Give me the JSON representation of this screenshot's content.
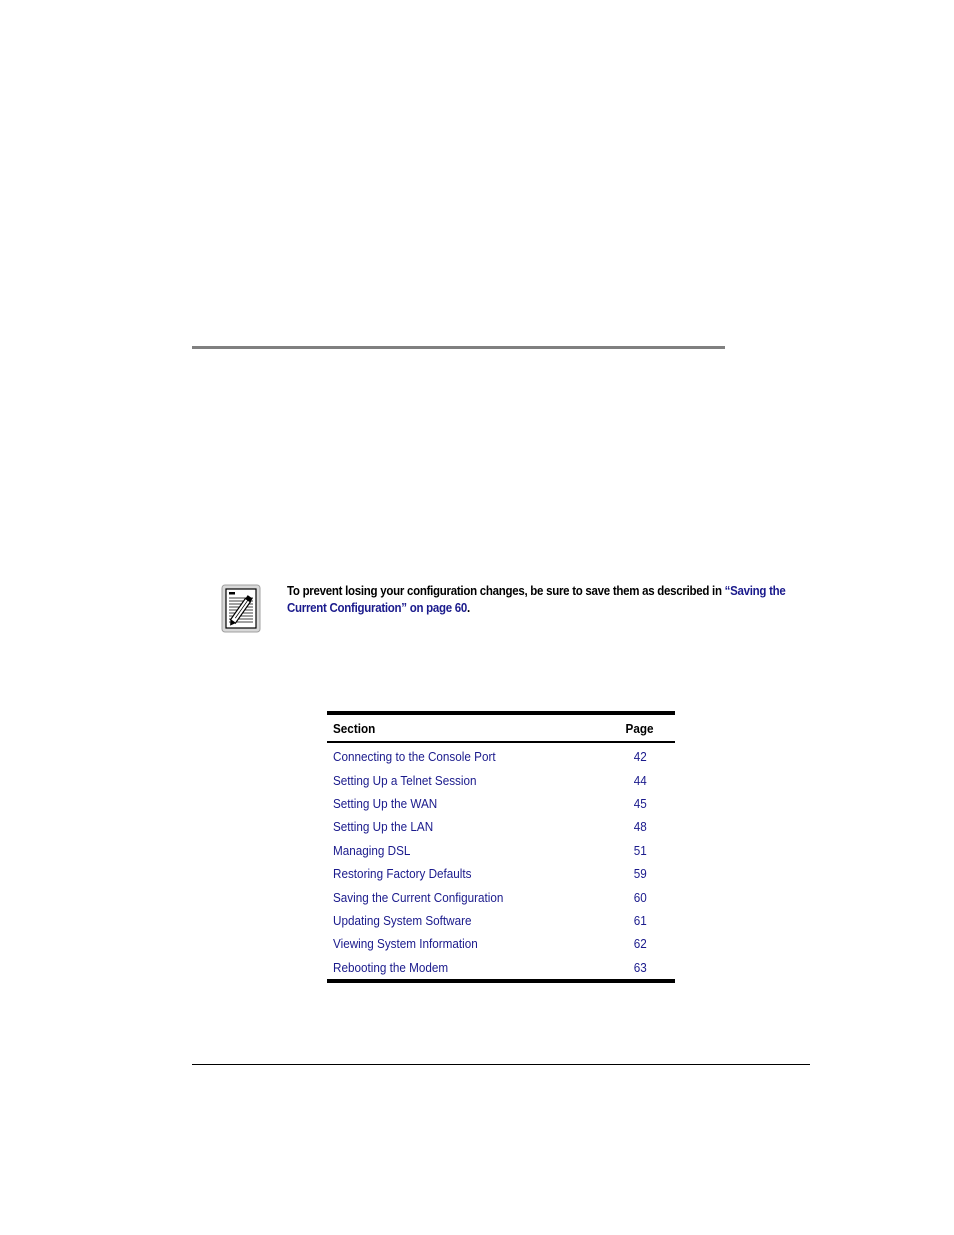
{
  "note": {
    "icon": "note-pencil-icon",
    "text_before": "To prevent losing your configuration changes, be sure to save them as described in ",
    "link_text": "“Saving the Current Configuration” on page 60",
    "text_after": ".",
    "link_color": "#1a1a8c"
  },
  "toc": {
    "headers": {
      "section": "Section",
      "page": "Page"
    },
    "rows": [
      {
        "section": "Connecting to the Console Port",
        "page": "42"
      },
      {
        "section": "Setting Up a Telnet Session",
        "page": "44"
      },
      {
        "section": "Setting Up the WAN",
        "page": "45"
      },
      {
        "section": "Setting Up the LAN",
        "page": "48"
      },
      {
        "section": "Managing DSL",
        "page": "51"
      },
      {
        "section": "Restoring Factory Defaults",
        "page": "59"
      },
      {
        "section": "Saving the Current Configuration",
        "page": "60"
      },
      {
        "section": "Updating System Software",
        "page": "61"
      },
      {
        "section": "Viewing System Information",
        "page": "62"
      },
      {
        "section": "Rebooting the Modem",
        "page": "63"
      }
    ]
  }
}
